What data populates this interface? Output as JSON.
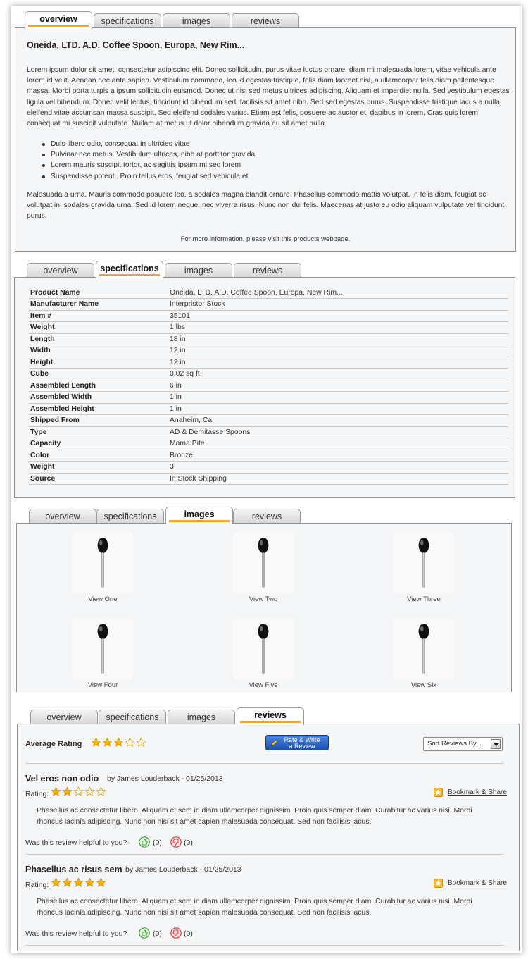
{
  "tabs": {
    "overview": "overview",
    "specifications": "specifications",
    "images": "images",
    "reviews": "reviews"
  },
  "overview": {
    "title": "Oneida, LTD. A.D. Coffee Spoon, Europa, New Rim...",
    "paragraph1": "Lorem ipsum dolor sit amet, consectetur adipiscing elit. Donec sollicitudin, purus vitae luctus ornare, diam mi malesuada lorem, vitae vehicula ante lorem id velit. Aenean nec ante sapien. Vestibulum commodo, leo id egestas tristique, felis diam laoreet nisl, a ullamcorper felis diam pellentesque massa. Morbi porta turpis a ipsum sollicitudin euismod. Donec ut nisi sed metus ultrices adipiscing. Aliquam et imperdiet nulla. Sed vestibulum egestas ligula vel bibendum. Donec velit lectus, tincidunt id bibendum sed, facilisis sit amet nibh. Sed sed egestas purus. Suspendisse tristique lacus a nulla eleifend vitae accumsan massa suscipit. Sed eleifend sodales varius. Etiam est felis, posuere ac auctor et, dapibus in lorem. Cras quis lorem consequat mi suscipit vulputate. Nullam at metus ut dolor bibendum gravida eu sit amet nulla.",
    "bullets": [
      "Duis libero odio, consequat in ultricies vitae",
      "Pulvinar nec metus. Vestibulum ultrices, nibh at porttitor gravida",
      "Lorem mauris suscipit tortor, ac sagittis ipsum mi sed lorem",
      "Suspendisse potenti. Proin tellus eros, feugiat sed vehicula et"
    ],
    "paragraph2": "Malesuada a urna. Mauris commodo posuere leo, a sodales magna blandit ornare. Phasellus commodo mattis volutpat. In felis diam, feugiat ac volutpat in, sodales gravida urna. Sed id lorem neque, nec viverra risus. Nunc non dui felis. Maecenas at justo eu odio aliquam vulputate vel tincidunt purus.",
    "more_info_prefix": "For more information, please visit this products ",
    "more_info_link": "webpage",
    "more_info_suffix": "."
  },
  "specifications": [
    {
      "key": "Product Name",
      "value": "Oneida, LTD. A.D. Coffee Spoon, Europa, New Rim..."
    },
    {
      "key": "Manufacturer Name",
      "value": "Interpristor Stock"
    },
    {
      "key": "Item #",
      "value": "35101"
    },
    {
      "key": "Weight",
      "value": "1 lbs"
    },
    {
      "key": "Length",
      "value": "18 in"
    },
    {
      "key": "Width",
      "value": "12 in"
    },
    {
      "key": "Height",
      "value": "12 in"
    },
    {
      "key": "Cube",
      "value": "0.02 sq ft"
    },
    {
      "key": "Assembled Length",
      "value": "6 in"
    },
    {
      "key": "Assembled Width",
      "value": "1 in"
    },
    {
      "key": "Assembled Height",
      "value": "1 in"
    },
    {
      "key": "Shipped From",
      "value": "Anaheim, Ca"
    },
    {
      "key": "Type",
      "value": "AD & Demitasse Spoons"
    },
    {
      "key": "Capacity",
      "value": "Mama Bite"
    },
    {
      "key": "Color",
      "value": "Bronze"
    },
    {
      "key": "Weight",
      "value": "3"
    },
    {
      "key": "Source",
      "value": "In Stock Shipping"
    }
  ],
  "images": [
    "View One",
    "View Two",
    "View Three",
    "View Four",
    "View Five",
    "View Six"
  ],
  "reviews": {
    "average_label": "Average Rating",
    "average_stars": 3,
    "rate_button_line1": "Rate & Write",
    "rate_button_line2": "a Review",
    "sort_label": "Sort Reviews By...",
    "rating_label": "Rating:",
    "bookmark_label": "Bookmark & Share",
    "helpful_label": "Was this review helpful to you?",
    "items": [
      {
        "title": "Vel eros non odio",
        "byline": "by James Louderback - 01/25/2013",
        "stars": 2,
        "body": "Phasellus ac consectetur libero. Aliquam et sem in diam ullamcorper dignissim. Proin quis semper diam. Curabitur ac varius nisi. Morbi rhoncus lacinia adipiscing. Nunc non nisi sit amet sapien malesuada consequat. Sed non facilisis lacus.",
        "yes_count": "(0)",
        "no_count": "(0)"
      },
      {
        "title": "Phasellus ac risus sem",
        "byline": "by James Louderback - 01/25/2013",
        "stars": 5,
        "body": "Phasellus ac consectetur libero. Aliquam et sem in diam ullamcorper dignissim. Proin quis semper diam. Curabitur ac varius nisi. Morbi rhoncus lacinia adipiscing. Nunc non nisi sit amet sapien malesuada consequat. Sed non facilisis lacus.",
        "yes_count": "(0)",
        "no_count": "(0)"
      }
    ]
  },
  "colors": {
    "tab_accent": "#f7a21b",
    "star": "#f5b301",
    "button_blue": "#1b4fb3"
  }
}
